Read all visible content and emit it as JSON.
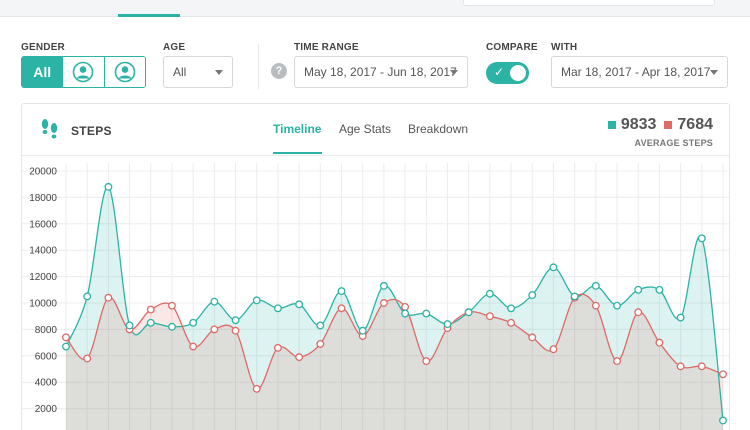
{
  "filters": {
    "gender": {
      "label": "GENDER",
      "options": [
        "All",
        "male-user-icon",
        "female-user-icon"
      ],
      "selected": "All"
    },
    "age": {
      "label": "AGE",
      "value": "All"
    },
    "time_range": {
      "label": "TIME RANGE",
      "value": "May 18, 2017 - Jun 18, 2017",
      "help": "?"
    },
    "compare": {
      "label": "COMPARE",
      "enabled": true,
      "check": "✓"
    },
    "with": {
      "label": "WITH",
      "value": "Mar 18, 2017 - Apr 18, 2017"
    }
  },
  "card": {
    "title": "STEPS",
    "tabs": [
      "Timeline",
      "Age Stats",
      "Breakdown"
    ],
    "active_tab": "Timeline",
    "legend": {
      "current_value": "9833",
      "compare_value": "7684",
      "subtitle": "AVERAGE STEPS",
      "current_color": "#2bb3a5",
      "compare_color": "#dd6b66"
    }
  },
  "chart_data": {
    "type": "area",
    "ylim": [
      0,
      20000
    ],
    "yticks": [
      2000,
      4000,
      6000,
      8000,
      10000,
      12000,
      14000,
      16000,
      18000,
      20000
    ],
    "grid": true,
    "series": [
      {
        "name": "9833",
        "color": "#2bb3a5",
        "values": [
          6700,
          10500,
          18800,
          8300,
          8500,
          8200,
          8500,
          10100,
          8700,
          10200,
          9600,
          9900,
          8300,
          10900,
          7900,
          11300,
          9200,
          9200,
          8400,
          9300,
          10700,
          9600,
          10600,
          12700,
          10500,
          11300,
          9800,
          11000,
          11000,
          8900,
          14900,
          1100
        ]
      },
      {
        "name": "7684",
        "color": "#dd6b66",
        "values": [
          7400,
          5800,
          10400,
          8000,
          9500,
          9800,
          6700,
          8000,
          7900,
          3500,
          6600,
          5900,
          6900,
          9600,
          7500,
          10000,
          9700,
          5600,
          8100,
          9300,
          9000,
          8500,
          7400,
          6500,
          10400,
          9800,
          5600,
          9300,
          7000,
          5200,
          5200,
          4600
        ]
      }
    ]
  }
}
